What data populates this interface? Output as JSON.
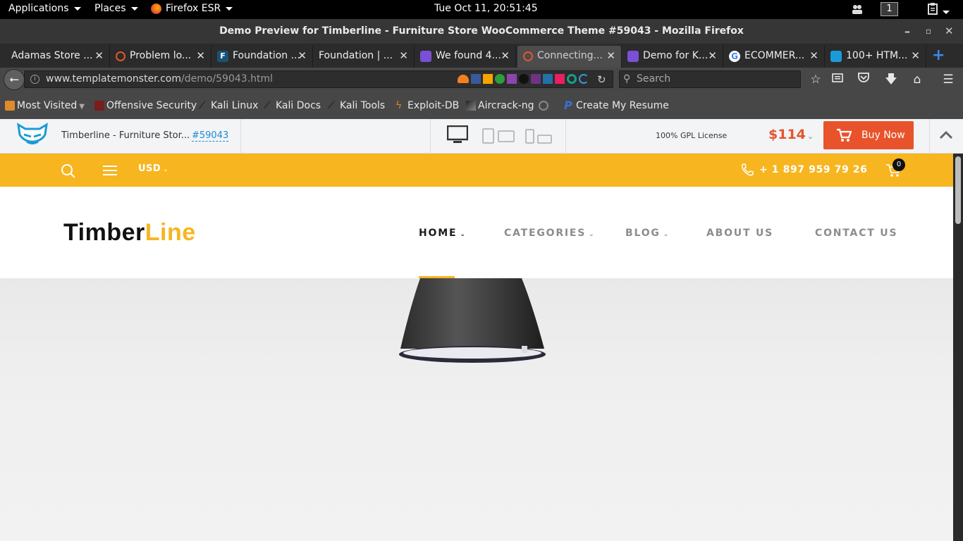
{
  "system_bar": {
    "applications": "Applications",
    "places": "Places",
    "firefox": "Firefox ESR",
    "clock": "Tue Oct 11, 20:51:45",
    "workspace": "1"
  },
  "window": {
    "title": "Demo Preview for Timberline - Furniture Store WooCommerce Theme #59043 - Mozilla Firefox"
  },
  "tabs": [
    {
      "label": "Adamas Store ...",
      "icon_color": "#2b2b2b"
    },
    {
      "label": "Problem lo...",
      "icon_color": "#e2572b"
    },
    {
      "label": "Foundation ...",
      "icon_color": "#1a5276"
    },
    {
      "label": "Foundation | ...",
      "icon_color": "#2b2b2b"
    },
    {
      "label": "We found 4...",
      "icon_color": "#7b4fd6"
    },
    {
      "label": "Connecting...",
      "icon_color": "#e2572b"
    },
    {
      "label": "Demo for K...",
      "icon_color": "#7b4fd6"
    },
    {
      "label": "ECOMMER...",
      "icon_color": "#ffffff"
    },
    {
      "label": "100+ HTM...",
      "icon_color": "#1a9bd7"
    }
  ],
  "active_tab_index": 5,
  "url": {
    "domain": "www.templatemonster.com",
    "path": "/demo/59043.html"
  },
  "search": {
    "placeholder": "Search"
  },
  "bookmarks": [
    {
      "label": "Most Visited",
      "icon": "folder-icon"
    },
    {
      "label": "Offensive Security",
      "icon": "offsec-icon"
    },
    {
      "label": "Kali Linux",
      "icon": "kali-dragon-icon"
    },
    {
      "label": "Kali Docs",
      "icon": "kali-dragon-icon"
    },
    {
      "label": "Kali Tools",
      "icon": "kali-dragon-icon"
    },
    {
      "label": "Exploit-DB",
      "icon": "exploitdb-icon"
    },
    {
      "label": "Aircrack-ng",
      "icon": "aircrack-icon"
    },
    {
      "label": "Create My Resume",
      "icon": "resume-p-icon"
    }
  ],
  "preview_bar": {
    "product_title": "Timberline - Furniture Stor...",
    "product_id": "#59043",
    "license": "100% GPL License",
    "price": "$114",
    "buy_label": "Buy Now"
  },
  "site": {
    "currency": "USD",
    "phone": "+ 1 897 959 79 26",
    "cart_count": "0",
    "logo_part1": "Timber",
    "logo_part2": "Line",
    "nav": [
      {
        "label": "HOME",
        "dropdown": true
      },
      {
        "label": "CATEGORIES",
        "dropdown": true
      },
      {
        "label": "BLOG",
        "dropdown": true
      },
      {
        "label": "ABOUT US",
        "dropdown": false
      },
      {
        "label": "CONTACT US",
        "dropdown": false
      }
    ]
  },
  "colors": {
    "accent_yellow": "#f7b520",
    "buy_button": "#e8532b",
    "price": "#e8532b"
  }
}
